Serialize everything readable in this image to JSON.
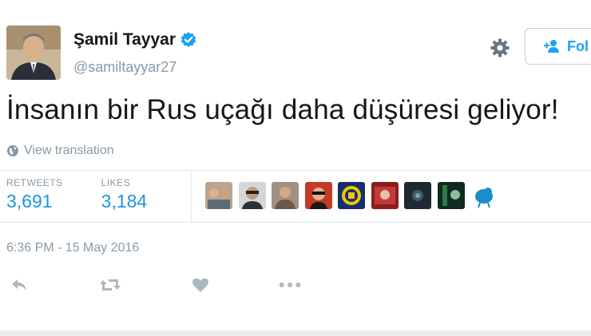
{
  "user": {
    "display_name": "Şamil Tayyar",
    "handle": "@samiltayyar27",
    "verified": true
  },
  "header": {
    "settings_icon": "gear-icon",
    "follow_label": "Fol"
  },
  "tweet": {
    "text": "İnsanın bir Rus uçağı daha düşüresi geliyor!",
    "translate_label": "View translation",
    "timestamp": "6:36 PM - 15 May 2016"
  },
  "stats": {
    "retweets_label": "RETWEETS",
    "retweets_value": "3,691",
    "likes_label": "LIKES",
    "likes_value": "3,184"
  },
  "likers_count_shown": 9,
  "actions": [
    "reply-icon",
    "retweet-icon",
    "like-icon",
    "more-icon"
  ],
  "colors": {
    "accent": "#1da1f2",
    "stat_value": "#1b95e0",
    "muted": "#8899a6",
    "verified": "#1da1f2"
  }
}
